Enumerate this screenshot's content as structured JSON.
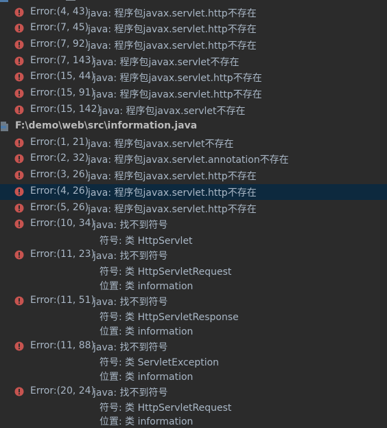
{
  "messages_panel": {
    "group_a_errors": [
      {
        "location": "Error:(4, 43)",
        "message": "java: 程序包javax.servlet.http不存在"
      },
      {
        "location": "Error:(7, 45)",
        "message": "java: 程序包javax.servlet.http不存在"
      },
      {
        "location": "Error:(7, 92)",
        "message": "java: 程序包javax.servlet.http不存在"
      },
      {
        "location": "Error:(7, 143)",
        "message": "java: 程序包javax.servlet不存在"
      },
      {
        "location": "Error:(15, 44)",
        "message": "java: 程序包javax.servlet.http不存在"
      },
      {
        "location": "Error:(15, 91)",
        "message": "java: 程序包javax.servlet.http不存在"
      },
      {
        "location": "Error:(15, 142)",
        "message": "java: 程序包javax.servlet不存在"
      }
    ],
    "file_group": {
      "path": "F:\\demo\\web\\src\\information.java",
      "icon": "java-file-icon"
    },
    "group_b_errors": [
      {
        "location": "Error:(1, 21)",
        "message": "java: 程序包javax.servlet不存在"
      },
      {
        "location": "Error:(2, 32)",
        "message": "java: 程序包javax.servlet.annotation不存在"
      },
      {
        "location": "Error:(3, 26)",
        "message": "java: 程序包javax.servlet.http不存在"
      },
      {
        "location": "Error:(4, 26)",
        "message": "java: 程序包javax.servlet.http不存在",
        "selected": true
      },
      {
        "location": "Error:(5, 26)",
        "message": "java: 程序包javax.servlet.http不存在"
      },
      {
        "location": "Error:(10, 34)",
        "message": "java: 找不到符号",
        "details": [
          "符号: 类 HttpServlet"
        ]
      },
      {
        "location": "Error:(11, 23)",
        "message": "java: 找不到符号",
        "details": [
          "符号:   类 HttpServletRequest",
          "位置: 类 information"
        ]
      },
      {
        "location": "Error:(11, 51)",
        "message": "java: 找不到符号",
        "details": [
          "符号:   类 HttpServletResponse",
          "位置: 类 information"
        ]
      },
      {
        "location": "Error:(11, 88)",
        "message": "java: 找不到符号",
        "details": [
          "符号:   类 ServletException",
          "位置: 类 information"
        ]
      },
      {
        "location": "Error:(20, 24)",
        "message": "java: 找不到符号",
        "details": [
          "符号:   类 HttpServletRequest",
          "位置: 类 information"
        ]
      }
    ],
    "colors": {
      "background": "#2b2b2b",
      "text": "#a9b7c6",
      "selected_row": "#0d293e",
      "error_icon": "#c75450"
    }
  }
}
